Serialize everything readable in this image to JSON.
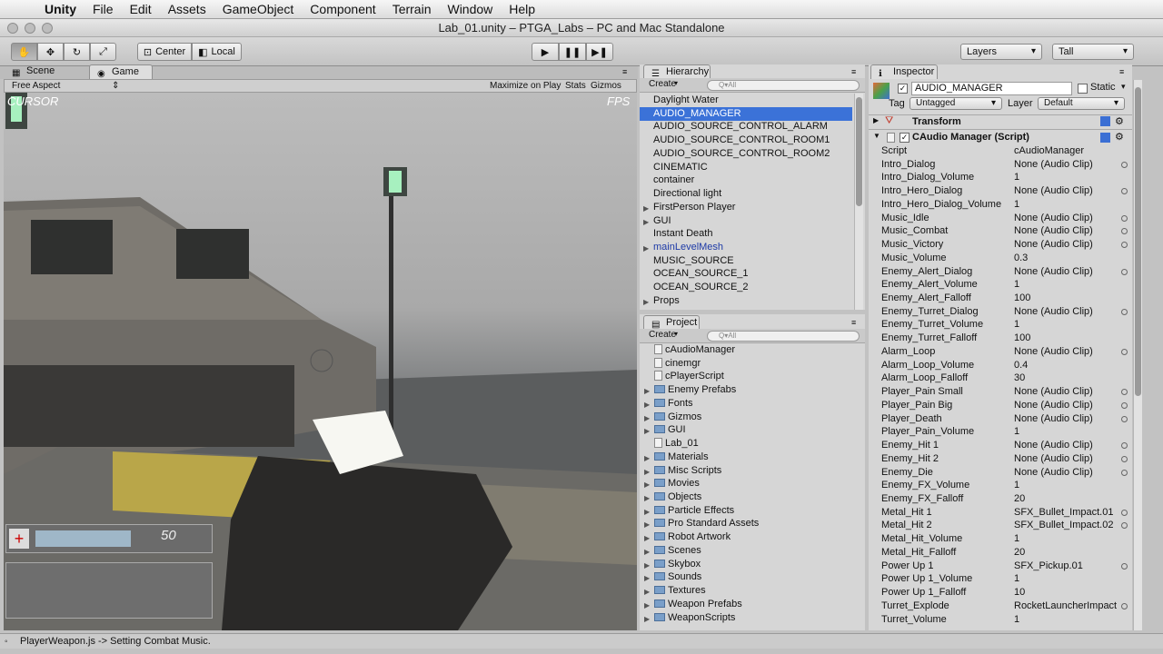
{
  "menubar": {
    "apple": "",
    "app": "Unity",
    "items": [
      "File",
      "Edit",
      "Assets",
      "GameObject",
      "Component",
      "Terrain",
      "Window",
      "Help"
    ]
  },
  "window": {
    "title": "Lab_01.unity – PTGA_Labs – PC and Mac Standalone"
  },
  "toolbar": {
    "center": "Center",
    "local": "Local",
    "layers": "Layers",
    "layout": "Tall"
  },
  "scene_tabs": {
    "scene": "Scene",
    "game": "Game"
  },
  "game_bar": {
    "aspect": "Free Aspect",
    "maximize": "Maximize on Play",
    "stats": "Stats",
    "gizmos": "Gizmos"
  },
  "game_view": {
    "hud_left": "CURSOR",
    "hud_right": "FPS",
    "ammo": "50"
  },
  "hierarchy": {
    "title": "Hierarchy",
    "create": "Create",
    "search_placeholder": "Q▾All",
    "items": [
      "Daylight Water",
      "AUDIO_MANAGER",
      "AUDIO_SOURCE_CONTROL_ALARM",
      "AUDIO_SOURCE_CONTROL_ROOM1",
      "AUDIO_SOURCE_CONTROL_ROOM2",
      "CINEMATIC",
      "container",
      "Directional light",
      "FirstPerson Player",
      "GUI",
      "Instant Death",
      "mainLevelMesh",
      "MUSIC_SOURCE",
      "OCEAN_SOURCE_1",
      "OCEAN_SOURCE_2",
      "Props"
    ]
  },
  "project": {
    "title": "Project",
    "create": "Create",
    "search_placeholder": "Q▾All",
    "items": [
      "cAudioManager",
      "cinemgr",
      "cPlayerScript",
      "Enemy Prefabs",
      "Fonts",
      "Gizmos",
      "GUI",
      "Lab_01",
      "Materials",
      "Misc Scripts",
      "Movies",
      "Objects",
      "Particle Effects",
      "Pro Standard Assets",
      "Robot Artwork",
      "Scenes",
      "Skybox",
      "Sounds",
      "Textures",
      "Weapon Prefabs",
      "WeaponScripts"
    ]
  },
  "inspector": {
    "title": "Inspector",
    "object_name": "AUDIO_MANAGER",
    "static": "Static",
    "tag_label": "Tag",
    "tag": "Untagged",
    "layer_label": "Layer",
    "layer": "Default",
    "transform": "Transform",
    "component": "CAudio Manager (Script)",
    "props": [
      [
        "Script",
        "cAudioManager"
      ],
      [
        "Intro_Dialog",
        "None (Audio Clip)"
      ],
      [
        "Intro_Dialog_Volume",
        "1"
      ],
      [
        "Intro_Hero_Dialog",
        "None (Audio Clip)"
      ],
      [
        "Intro_Hero_Dialog_Volume",
        "1"
      ],
      [
        "Music_Idle",
        "None (Audio Clip)"
      ],
      [
        "Music_Combat",
        "None (Audio Clip)"
      ],
      [
        "Music_Victory",
        "None (Audio Clip)"
      ],
      [
        "Music_Volume",
        "0.3"
      ],
      [
        "Enemy_Alert_Dialog",
        "None (Audio Clip)"
      ],
      [
        "Enemy_Alert_Volume",
        "1"
      ],
      [
        "Enemy_Alert_Falloff",
        "100"
      ],
      [
        "Enemy_Turret_Dialog",
        "None (Audio Clip)"
      ],
      [
        "Enemy_Turret_Volume",
        "1"
      ],
      [
        "Enemy_Turret_Falloff",
        "100"
      ],
      [
        "Alarm_Loop",
        "None (Audio Clip)"
      ],
      [
        "Alarm_Loop_Volume",
        "0.4"
      ],
      [
        "Alarm_Loop_Falloff",
        "30"
      ],
      [
        "Player_Pain Small",
        "None (Audio Clip)"
      ],
      [
        "Player_Pain Big",
        "None (Audio Clip)"
      ],
      [
        "Player_Death",
        "None (Audio Clip)"
      ],
      [
        "Player_Pain_Volume",
        "1"
      ],
      [
        "Enemy_Hit 1",
        "None (Audio Clip)"
      ],
      [
        "Enemy_Hit 2",
        "None (Audio Clip)"
      ],
      [
        "Enemy_Die",
        "None (Audio Clip)"
      ],
      [
        "Enemy_FX_Volume",
        "1"
      ],
      [
        "Enemy_FX_Falloff",
        "20"
      ],
      [
        "Metal_Hit 1",
        "SFX_Bullet_Impact.01"
      ],
      [
        "Metal_Hit 2",
        "SFX_Bullet_Impact.02"
      ],
      [
        "Metal_Hit_Volume",
        "1"
      ],
      [
        "Metal_Hit_Falloff",
        "20"
      ],
      [
        "Power Up 1",
        "SFX_Pickup.01"
      ],
      [
        "Power Up 1_Volume",
        "1"
      ],
      [
        "Power Up 1_Falloff",
        "10"
      ],
      [
        "Turret_Explode",
        "RocketLauncherImpact"
      ],
      [
        "Turret_Volume",
        "1"
      ]
    ]
  },
  "status": {
    "message": "PlayerWeapon.js -> Setting Combat Music."
  }
}
